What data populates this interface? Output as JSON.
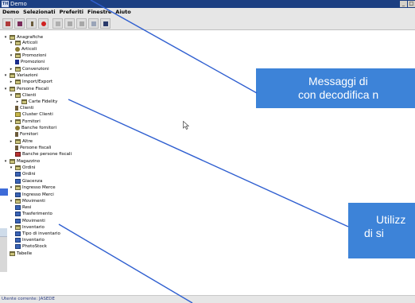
{
  "window": {
    "app_icon_text": "TH",
    "title": "Demo",
    "buttons": [
      "_",
      "□"
    ]
  },
  "menubar": {
    "items": [
      "Demo",
      "Selezionati",
      "Preferiti",
      "Finestre",
      "Aiuto"
    ]
  },
  "toolbar": {
    "buttons": [
      "app-icon",
      "grid-icon",
      "key-icon",
      "stop-icon",
      "flag-icon",
      "table-icon",
      "table-icon",
      "table-icon",
      "print-icon"
    ]
  },
  "tree": [
    {
      "label": "Anagrafiche",
      "icon": "folder-icon",
      "toggle": "open"
    },
    {
      "label": "Articoli",
      "icon": "folder-icon",
      "toggle": "open"
    },
    {
      "label": "Articoli",
      "icon": "gear-icon",
      "toggle": ""
    },
    {
      "label": "Promozioni",
      "icon": "folder-icon",
      "toggle": "open"
    },
    {
      "label": "Promozioni",
      "icon": "flag-icon",
      "toggle": ""
    },
    {
      "label": "Convenzioni",
      "icon": "folder-icon",
      "toggle": "closed"
    },
    {
      "label": "Variazioni",
      "icon": "folder-icon",
      "toggle": "open"
    },
    {
      "label": "Import/Export",
      "icon": "folder-icon",
      "toggle": "closed"
    },
    {
      "label": "Persone Fiscali",
      "icon": "folder-icon",
      "toggle": "open"
    },
    {
      "label": "Clienti",
      "icon": "folder-icon",
      "toggle": "open"
    },
    {
      "label": "Carte Fidelity",
      "icon": "folder-icon",
      "toggle": "closed"
    },
    {
      "label": "Clienti",
      "icon": "person-icon",
      "toggle": ""
    },
    {
      "label": "Cluster Clienti",
      "icon": "tag-icon",
      "toggle": ""
    },
    {
      "label": "Fornitori",
      "icon": "folder-icon",
      "toggle": "open"
    },
    {
      "label": "Banche fornitori",
      "icon": "gear-icon",
      "toggle": ""
    },
    {
      "label": "Fornitori",
      "icon": "person-icon",
      "toggle": ""
    },
    {
      "label": "Altre",
      "icon": "folder-icon",
      "toggle": "closed"
    },
    {
      "label": "Persone fiscali",
      "icon": "person-icon",
      "toggle": ""
    },
    {
      "label": "Banche persone fiscali",
      "icon": "red-icon",
      "toggle": ""
    },
    {
      "label": "Magazzino",
      "icon": "folder-icon",
      "toggle": "open"
    },
    {
      "label": "Ordini",
      "icon": "folder-icon",
      "toggle": "open"
    },
    {
      "label": "Ordini",
      "icon": "table-icon",
      "toggle": ""
    },
    {
      "label": "Giacenza",
      "icon": "table-icon",
      "toggle": ""
    },
    {
      "label": "Ingresso Merce",
      "icon": "folder-icon",
      "toggle": "open"
    },
    {
      "label": "Ingresso Merci",
      "icon": "table-icon",
      "toggle": ""
    },
    {
      "label": "Movimenti",
      "icon": "folder-icon",
      "toggle": "open"
    },
    {
      "label": "Resi",
      "icon": "table-icon",
      "toggle": ""
    },
    {
      "label": "Trasferimento",
      "icon": "table-icon",
      "toggle": ""
    },
    {
      "label": "Movimenti",
      "icon": "table-icon",
      "toggle": ""
    },
    {
      "label": "Inventario",
      "icon": "folder-icon",
      "toggle": "open"
    },
    {
      "label": "Tipo di inventario",
      "icon": "table-icon",
      "toggle": ""
    },
    {
      "label": "Inventario",
      "icon": "table-icon",
      "toggle": ""
    },
    {
      "label": "PhotoStock",
      "icon": "table-icon",
      "toggle": ""
    },
    {
      "label": "Tabelle",
      "icon": "folder-icon",
      "toggle": "closed"
    }
  ],
  "statusbar": {
    "text": "Utente corrente: JASEDE"
  },
  "callouts": [
    {
      "line1": "Messaggi di",
      "line2": "con decodifica n"
    },
    {
      "line1": "Utilizz",
      "line2": "di si"
    }
  ],
  "colors": {
    "callout": "#3d83d8",
    "titlebar": "#1c3f82",
    "pointer_line": "#2f5fd0"
  }
}
